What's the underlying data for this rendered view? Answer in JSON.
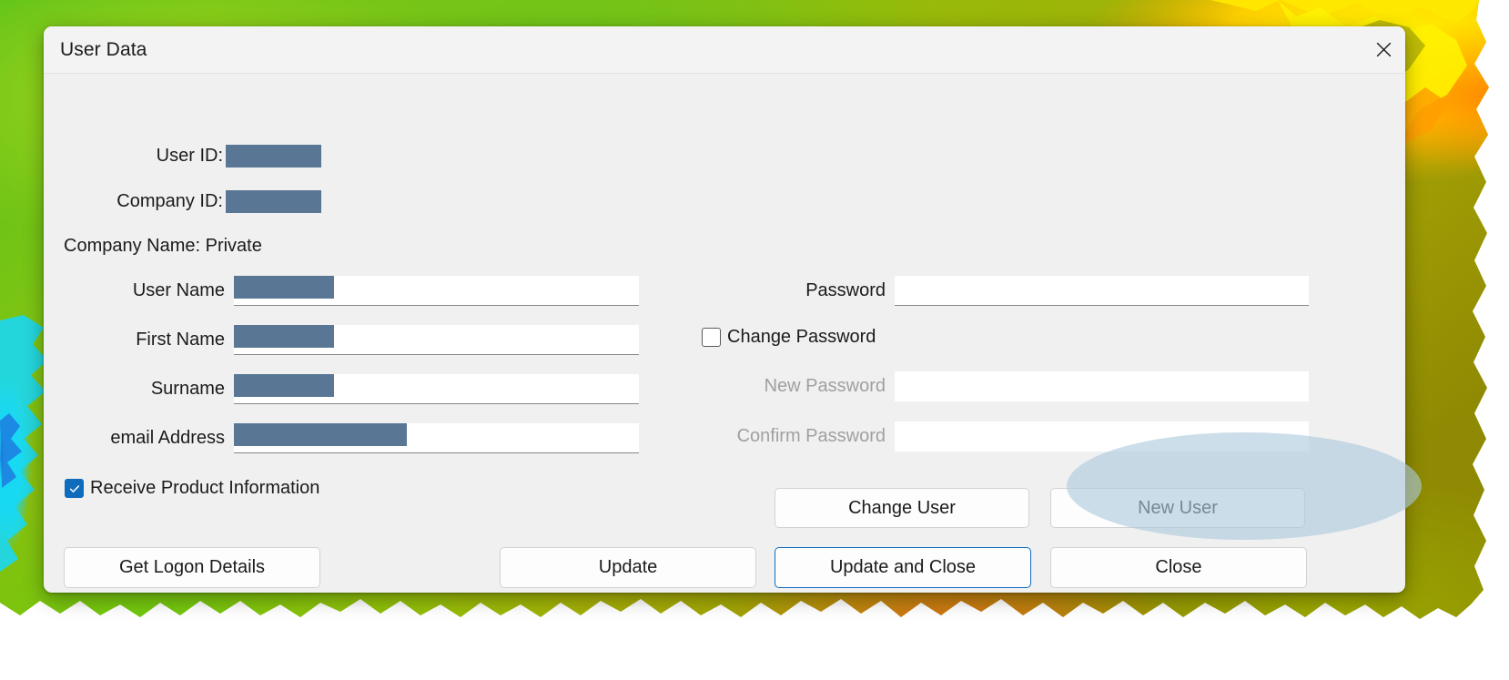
{
  "window": {
    "title": "User Data",
    "close_icon": "close-icon"
  },
  "identity": {
    "user_id_label": "User ID:",
    "user_id_value": "",
    "company_id_label": "Company ID:",
    "company_id_value": "",
    "company_name_line": "Company Name: Private"
  },
  "left_fields": [
    {
      "label": "User Name",
      "value": "",
      "redacted": true
    },
    {
      "label": "First Name",
      "value": "",
      "redacted": true
    },
    {
      "label": "Surname",
      "value": "",
      "redacted": true
    },
    {
      "label": "email Address",
      "value": "",
      "redacted": true
    }
  ],
  "right_fields": [
    {
      "label": "Password",
      "value": "",
      "disabled": false
    },
    {
      "label": "New Password",
      "value": "",
      "disabled": true
    },
    {
      "label": "Confirm Password",
      "value": "",
      "disabled": true
    }
  ],
  "checkboxes": {
    "change_password": {
      "label": "Change Password",
      "checked": false
    },
    "receive_product_information": {
      "label": "Receive Product Information",
      "checked": true
    }
  },
  "buttons": {
    "change_user": "Change User",
    "new_user": "New User",
    "get_logon_details": "Get Logon Details",
    "update": "Update",
    "update_and_close": "Update and Close",
    "close": "Close"
  },
  "colors": {
    "accent": "#0f6cbd",
    "redaction": "#597795",
    "dialog_bg": "#f0f0f0",
    "titlebar_bg": "#f3f3f3",
    "highlight": "#abc9dd",
    "disabled_text": "#a0a0a0"
  }
}
